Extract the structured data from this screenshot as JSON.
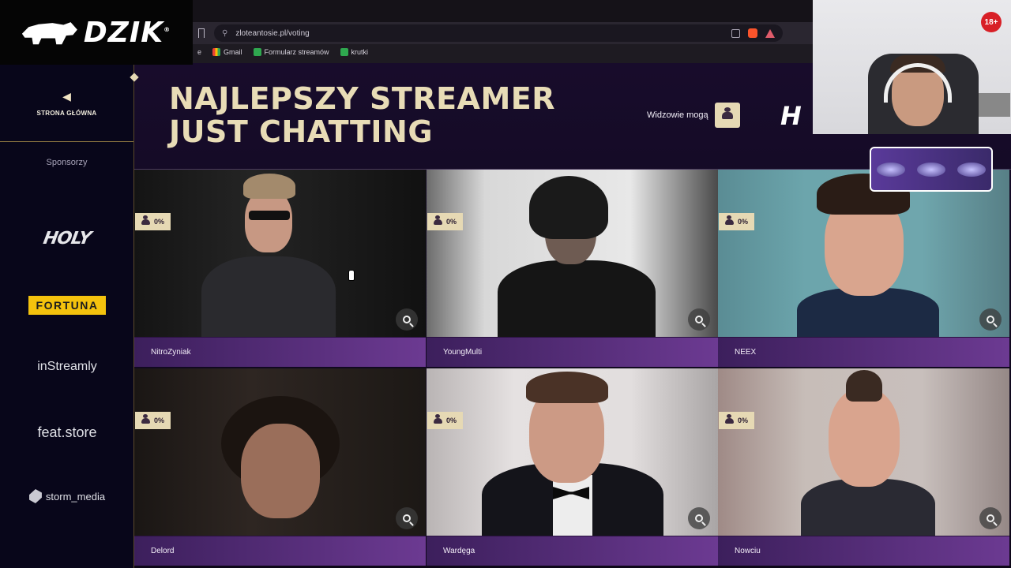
{
  "browser": {
    "url": "zloteantosie.pl/voting",
    "bookmarks": [
      {
        "label": "Gmail",
        "icon": "gmail-icon"
      },
      {
        "label": "Formularz streamów",
        "icon": "sheet-icon"
      },
      {
        "label": "krutki",
        "icon": "sheet-icon"
      }
    ]
  },
  "logo": {
    "text": "DZIK",
    "mark": "®"
  },
  "sidebar": {
    "home_label": "STRONA GŁÓWNA",
    "sponsors_title": "Sponsorzy",
    "sponsors": [
      "HOLY",
      "FORTUNA",
      "inStreamly",
      "feat.store",
      "storm_media"
    ]
  },
  "header": {
    "title": "NAJLEPSZY STREAMER JUST CHATTING",
    "viewers_label": "Widzowie mogą"
  },
  "overlay": {
    "age_badge": "18+",
    "brand_fragment": "H"
  },
  "candidates": [
    {
      "name": "NitroZyniak",
      "percent": "0%"
    },
    {
      "name": "YoungMulti",
      "percent": "0%"
    },
    {
      "name": "NEEX",
      "percent": "0%"
    },
    {
      "name": "Delord",
      "percent": "0%"
    },
    {
      "name": "Wardęga",
      "percent": "0%"
    },
    {
      "name": "Nowciu",
      "percent": "0%"
    }
  ],
  "colors": {
    "accent_gold": "#e6d9b4",
    "title_gold": "#e8dcb6",
    "namebar_start": "#3c1f5c",
    "namebar_end": "#6c3a92"
  }
}
